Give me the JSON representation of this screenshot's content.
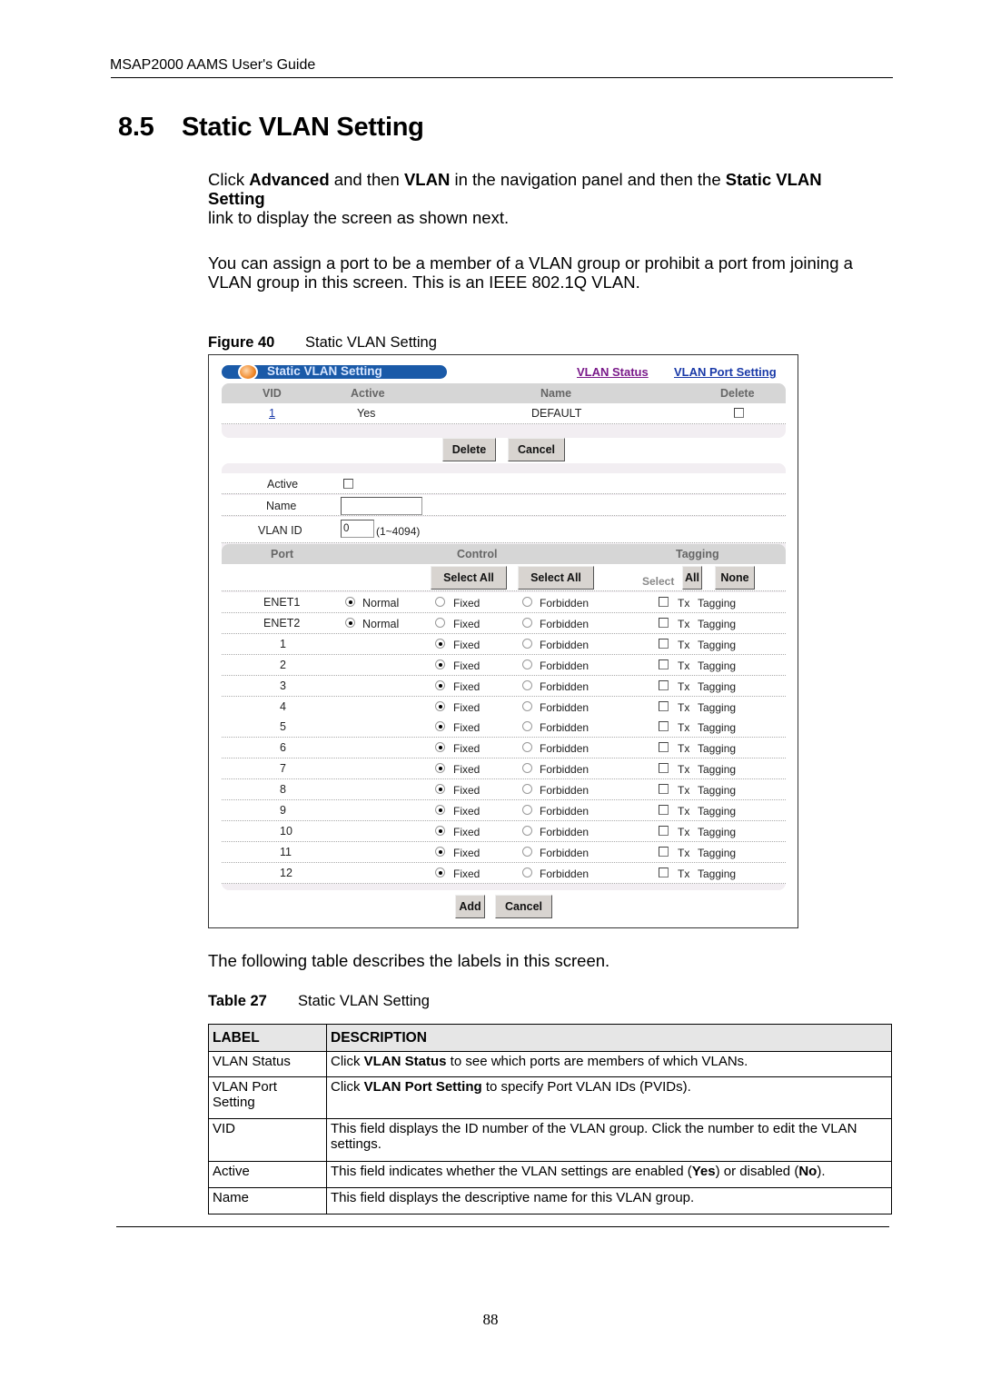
{
  "document": {
    "running_header": "MSAP2000 AAMS User's Guide",
    "section_number": "8.5",
    "section_title": "Static VLAN Setting",
    "para1": {
      "t1": "Click ",
      "b1": "Advanced",
      "t2": " and then ",
      "b2": "VLAN",
      "t3": " in the navigation panel and then the ",
      "b3": "Static VLAN Setting",
      "t4": "link to display the screen as shown next."
    },
    "para2": {
      "line1": "You can assign a port to be a member of a VLAN group or prohibit a port from joining a",
      "line2": "VLAN group in this screen. This is an IEEE 802.1Q VLAN."
    },
    "figure_label": "Figure 40",
    "figure_title": "Static VLAN Setting",
    "table_intro": "The following table describes the labels in this screen.",
    "table_label": "Table 27",
    "table_title": "Static VLAN Setting",
    "page_number": "88"
  },
  "screen": {
    "title": "Static VLAN Setting",
    "links": {
      "vlan_status": "VLAN Status",
      "vlan_port_setting": "VLAN Port Setting"
    },
    "vlan_table": {
      "headers": {
        "vid": "VID",
        "active": "Active",
        "name": "Name",
        "delete": "Delete"
      },
      "rows": [
        {
          "vid": "1",
          "active": "Yes",
          "name": "DEFAULT",
          "delete_checked": false
        }
      ]
    },
    "delete_button": "Delete",
    "cancel_button": "Cancel",
    "form": {
      "active_label": "Active",
      "active_checked": false,
      "name_label": "Name",
      "name_value": "",
      "vlan_id_label": "VLAN  ID",
      "vlan_id_value": "0",
      "vlan_id_range": "(1~4094)"
    },
    "port_table": {
      "headers": {
        "port": "Port",
        "control": "Control",
        "tagging": "Tagging"
      },
      "select_all_fixed": "Select All",
      "select_all_forbidden": "Select All",
      "select_label": "Select",
      "all_button": "All",
      "none_button": "None",
      "option_labels": {
        "normal": "Normal",
        "fixed": "Fixed",
        "forbidden": "Forbidden",
        "tx": "Tx",
        "tagging": "Tagging"
      },
      "rows": [
        {
          "port": "ENET1",
          "has_normal": true,
          "control": "normal",
          "tx_tagging": false
        },
        {
          "port": "ENET2",
          "has_normal": true,
          "control": "normal",
          "tx_tagging": false
        },
        {
          "port": "1",
          "has_normal": false,
          "control": "fixed",
          "tx_tagging": false
        },
        {
          "port": "2",
          "has_normal": false,
          "control": "fixed",
          "tx_tagging": false
        },
        {
          "port": "3",
          "has_normal": false,
          "control": "fixed",
          "tx_tagging": false
        },
        {
          "port": "4",
          "has_normal": false,
          "control": "fixed",
          "tx_tagging": false
        },
        {
          "port": "5",
          "has_normal": false,
          "control": "fixed",
          "tx_tagging": false
        },
        {
          "port": "6",
          "has_normal": false,
          "control": "fixed",
          "tx_tagging": false
        },
        {
          "port": "7",
          "has_normal": false,
          "control": "fixed",
          "tx_tagging": false
        },
        {
          "port": "8",
          "has_normal": false,
          "control": "fixed",
          "tx_tagging": false
        },
        {
          "port": "9",
          "has_normal": false,
          "control": "fixed",
          "tx_tagging": false
        },
        {
          "port": "10",
          "has_normal": false,
          "control": "fixed",
          "tx_tagging": false
        },
        {
          "port": "11",
          "has_normal": false,
          "control": "fixed",
          "tx_tagging": false
        },
        {
          "port": "12",
          "has_normal": false,
          "control": "fixed",
          "tx_tagging": false
        }
      ]
    },
    "add_button": "Add",
    "cancel2_button": "Cancel"
  },
  "desc_table": {
    "headers": {
      "label": "LABEL",
      "description": "DESCRIPTION"
    },
    "rows": [
      {
        "label": "VLAN Status",
        "pre": "Click ",
        "bold": "VLAN Status",
        "post": " to see which ports are members of which VLANs."
      },
      {
        "label": "VLAN Port Setting",
        "pre": "Click ",
        "bold": "VLAN Port Setting",
        "post": " to specify Port VLAN IDs (PVIDs)."
      },
      {
        "label": "VID",
        "pre": "This field displays the ID number of the VLAN group. Click the number to edit the VLAN settings.",
        "bold": "",
        "post": ""
      },
      {
        "label": "Active",
        "pre": "This field indicates whether the VLAN settings are enabled (",
        "bold": "Yes",
        "post": ") or disabled (",
        "bold2": "No",
        "post2": ")."
      },
      {
        "label": "Name",
        "pre": "This field displays the descriptive name for this VLAN group.",
        "bold": "",
        "post": ""
      }
    ]
  },
  "colors": {
    "title_bar": "#1a5aa8",
    "link_visited": "#7a1a8a",
    "link": "#1a3aa8",
    "panel_header": "#d6d6d6",
    "panel_bg": "#f2eef2"
  }
}
